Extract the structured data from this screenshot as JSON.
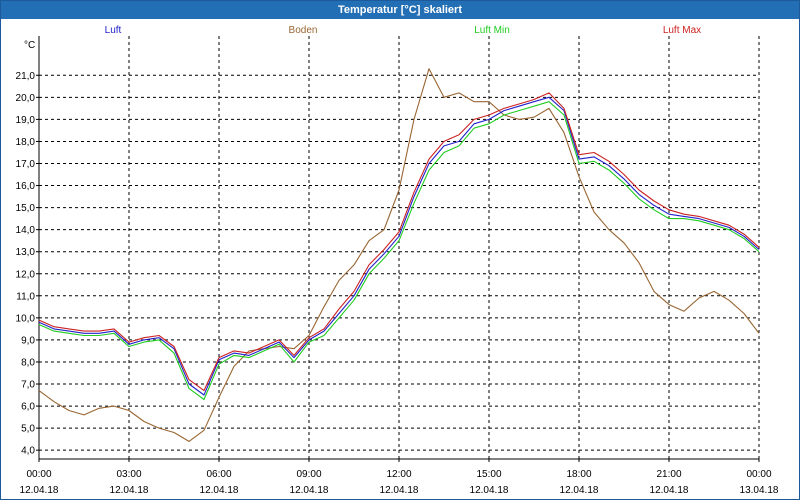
{
  "window": {
    "title": "Temperatur [°C] skaliert"
  },
  "colors": {
    "Luft": "#2222cc",
    "Boden": "#996633",
    "Luft Min": "#22cc22",
    "Luft Max": "#cc2222"
  },
  "chart_data": {
    "type": "line",
    "title": "Temperatur [°C] skaliert",
    "ylabel": "°C",
    "xlabel": "",
    "ylim": [
      3.6,
      22.6
    ],
    "xlim": [
      "12.04.18 00:00",
      "13.04.18 00:00"
    ],
    "grid": true,
    "legend_position": "top",
    "yticks": [
      "4,0",
      "5,0",
      "6,0",
      "7,0",
      "8,0",
      "9,0",
      "10,0",
      "11,0",
      "12,0",
      "13,0",
      "14,0",
      "15,0",
      "16,0",
      "17,0",
      "18,0",
      "19,0",
      "20,0",
      "21,0"
    ],
    "xticks": [
      {
        "time": "00:00",
        "date": "12.04.18"
      },
      {
        "time": "03:00",
        "date": "12.04.18"
      },
      {
        "time": "06:00",
        "date": "12.04.18"
      },
      {
        "time": "09:00",
        "date": "12.04.18"
      },
      {
        "time": "12:00",
        "date": "12.04.18"
      },
      {
        "time": "15:00",
        "date": "12.04.18"
      },
      {
        "time": "18:00",
        "date": "12.04.18"
      },
      {
        "time": "21:00",
        "date": "12.04.18"
      },
      {
        "time": "00:00",
        "date": "13.04.18"
      }
    ],
    "x_hours": [
      0,
      0.5,
      1,
      1.5,
      2,
      2.5,
      3,
      3.5,
      4,
      4.5,
      5,
      5.5,
      6,
      6.5,
      7,
      7.5,
      8,
      8.5,
      9,
      9.5,
      10,
      10.5,
      11,
      11.5,
      12,
      12.5,
      13,
      13.5,
      14,
      14.5,
      15,
      15.5,
      16,
      16.5,
      17,
      17.5,
      18,
      18.5,
      19,
      19.5,
      20,
      20.5,
      21,
      21.5,
      22,
      22.5,
      23,
      23.5,
      24
    ],
    "series": [
      {
        "name": "Luft",
        "values": [
          9.8,
          9.5,
          9.4,
          9.3,
          9.3,
          9.4,
          8.8,
          9.0,
          9.1,
          8.6,
          7.0,
          6.5,
          8.1,
          8.4,
          8.3,
          8.6,
          8.9,
          8.2,
          9.0,
          9.4,
          10.2,
          11.0,
          12.2,
          12.9,
          13.7,
          15.5,
          17.0,
          17.8,
          18.0,
          18.8,
          19.0,
          19.4,
          19.6,
          19.8,
          20.0,
          19.4,
          17.2,
          17.3,
          16.9,
          16.3,
          15.6,
          15.1,
          14.7,
          14.6,
          14.5,
          14.3,
          14.1,
          13.7,
          13.1
        ]
      },
      {
        "name": "Boden",
        "values": [
          6.7,
          6.2,
          5.8,
          5.6,
          5.9,
          6.0,
          5.8,
          5.3,
          5.0,
          4.8,
          4.4,
          4.9,
          6.4,
          7.8,
          8.5,
          8.6,
          8.7,
          8.6,
          9.2,
          10.5,
          11.7,
          12.4,
          13.5,
          14.0,
          15.8,
          19.0,
          21.3,
          20.0,
          20.2,
          19.8,
          19.8,
          19.2,
          19.0,
          19.1,
          19.5,
          18.4,
          16.4,
          14.8,
          14.0,
          13.4,
          12.5,
          11.2,
          10.6,
          10.3,
          10.9,
          11.2,
          10.8,
          10.2,
          9.3
        ]
      },
      {
        "name": "Luft Min",
        "values": [
          9.7,
          9.4,
          9.3,
          9.2,
          9.2,
          9.3,
          8.7,
          8.9,
          9.0,
          8.4,
          6.8,
          6.3,
          7.9,
          8.3,
          8.2,
          8.5,
          8.8,
          8.0,
          8.9,
          9.2,
          10.0,
          10.8,
          12.0,
          12.7,
          13.5,
          15.2,
          16.7,
          17.5,
          17.8,
          18.6,
          18.8,
          19.2,
          19.4,
          19.6,
          19.8,
          19.2,
          17.0,
          17.1,
          16.7,
          16.1,
          15.4,
          14.9,
          14.5,
          14.5,
          14.4,
          14.2,
          14.0,
          13.6,
          13.0
        ]
      },
      {
        "name": "Luft Max",
        "values": [
          9.9,
          9.6,
          9.5,
          9.4,
          9.4,
          9.5,
          8.9,
          9.1,
          9.2,
          8.7,
          7.2,
          6.7,
          8.2,
          8.5,
          8.4,
          8.7,
          9.0,
          8.3,
          9.1,
          9.5,
          10.4,
          11.2,
          12.4,
          13.1,
          13.9,
          15.7,
          17.2,
          18.0,
          18.3,
          19.0,
          19.2,
          19.5,
          19.7,
          19.9,
          20.2,
          19.5,
          17.4,
          17.5,
          17.1,
          16.5,
          15.8,
          15.3,
          14.9,
          14.7,
          14.6,
          14.4,
          14.2,
          13.8,
          13.2
        ]
      }
    ]
  }
}
